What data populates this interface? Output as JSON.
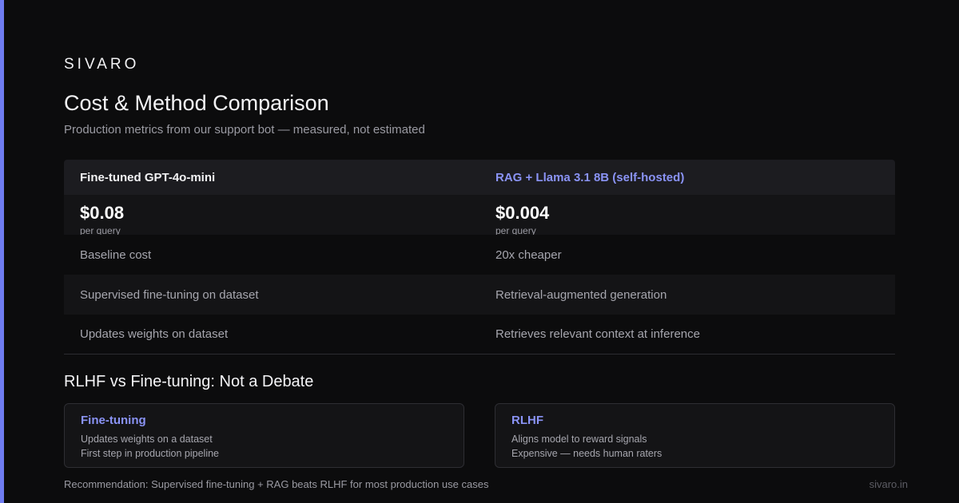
{
  "brand": "SIVARO",
  "title": "Cost & Method Comparison",
  "subtitle": "Production metrics from our support bot — measured, not estimated",
  "comparison": {
    "left": {
      "name": "Fine-tuned GPT-4o-mini",
      "price": "$0.08",
      "unit": "per query",
      "rows": [
        "Baseline cost",
        "Supervised fine-tuning on dataset",
        "Updates weights on dataset"
      ]
    },
    "right": {
      "name": "RAG + Llama 3.1 8B (self-hosted)",
      "price": "$0.004",
      "unit": "per query",
      "rows": [
        "20x cheaper",
        "Retrieval-augmented generation",
        "Retrieves relevant context at inference"
      ]
    }
  },
  "section2": {
    "title": "RLHF vs Fine-tuning: Not a Debate",
    "cards": [
      {
        "title": "Fine-tuning",
        "lines": [
          "Updates weights on a dataset",
          "First step in production pipeline"
        ]
      },
      {
        "title": "RLHF",
        "lines": [
          "Aligns model to reward signals",
          "Expensive — needs human raters"
        ]
      }
    ]
  },
  "footer": {
    "recommendation": "Recommendation: Supervised fine-tuning + RAG beats RLHF for most production use cases",
    "site": "sivaro.in"
  },
  "colors": {
    "background": "#0c0c0d",
    "accent": "#6f7cf0",
    "highlight_text": "#8a93f5"
  }
}
